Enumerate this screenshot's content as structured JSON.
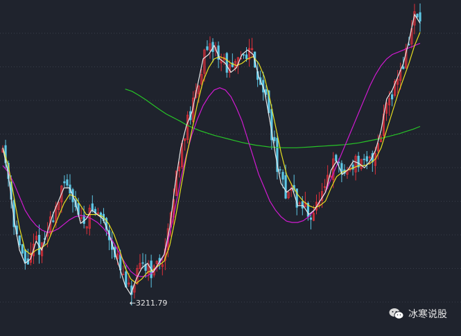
{
  "watermark": {
    "text": "冰寒说股",
    "icon": "wechat-icon"
  },
  "colors": {
    "background": "#1f232d",
    "grid": "#3a3f4b",
    "up": "#e0303a",
    "down": "#5ec8e6",
    "ma_white": "#e9e9e9",
    "ma_yellow": "#e8e020",
    "ma_magenta": "#d21ad2",
    "ma_green": "#27c427"
  },
  "chart_data": {
    "type": "candlestick",
    "grid": true,
    "low_marker": {
      "label": "3211.79",
      "value": 3211.79
    },
    "y_range": [
      3160,
      3880
    ],
    "close_path": [
      3560,
      3500,
      3400,
      3330,
      3300,
      3310,
      3350,
      3330,
      3370,
      3410,
      3440,
      3470,
      3470,
      3440,
      3390,
      3400,
      3420,
      3410,
      3400,
      3370,
      3330,
      3290,
      3250,
      3230,
      3265,
      3290,
      3300,
      3280,
      3300,
      3320,
      3380,
      3480,
      3560,
      3610,
      3640,
      3700,
      3760,
      3770,
      3790,
      3760,
      3750,
      3730,
      3740,
      3770,
      3780,
      3770,
      3720,
      3690,
      3620,
      3545,
      3480,
      3460,
      3470,
      3430,
      3430,
      3410,
      3420,
      3440,
      3460,
      3510,
      3530,
      3500,
      3510,
      3530,
      3525,
      3515,
      3530,
      3555,
      3600,
      3670,
      3690,
      3720,
      3750,
      3800,
      3860,
      3840
    ],
    "ma_short": [
      3560,
      3520,
      3450,
      3380,
      3330,
      3320,
      3330,
      3335,
      3345,
      3375,
      3405,
      3435,
      3455,
      3450,
      3430,
      3410,
      3410,
      3410,
      3405,
      3390,
      3365,
      3330,
      3290,
      3265,
      3255,
      3265,
      3280,
      3285,
      3295,
      3305,
      3340,
      3400,
      3470,
      3540,
      3600,
      3660,
      3710,
      3740,
      3760,
      3765,
      3760,
      3750,
      3745,
      3750,
      3760,
      3765,
      3750,
      3720,
      3670,
      3610,
      3550,
      3500,
      3475,
      3455,
      3440,
      3430,
      3425,
      3430,
      3440,
      3470,
      3495,
      3505,
      3510,
      3515,
      3520,
      3520,
      3525,
      3535,
      3560,
      3600,
      3640,
      3680,
      3715,
      3750,
      3790,
      3820
    ],
    "ma_mid": [
      3520,
      3505,
      3480,
      3450,
      3420,
      3400,
      3385,
      3375,
      3370,
      3372,
      3378,
      3388,
      3398,
      3405,
      3408,
      3405,
      3400,
      3392,
      3380,
      3365,
      3345,
      3322,
      3300,
      3282,
      3272,
      3270,
      3272,
      3280,
      3295,
      3320,
      3365,
      3425,
      3490,
      3545,
      3590,
      3625,
      3655,
      3675,
      3690,
      3695,
      3690,
      3675,
      3650,
      3620,
      3580,
      3540,
      3500,
      3470,
      3440,
      3420,
      3405,
      3395,
      3392,
      3392,
      3396,
      3405,
      3420,
      3440,
      3460,
      3490,
      3520,
      3550,
      3580,
      3610,
      3640,
      3670,
      3700,
      3725,
      3745,
      3760,
      3770,
      3775,
      3780,
      3785,
      3790,
      3795
    ],
    "ma_long": {
      "x_start_index": 22,
      "values": [
        3692,
        3687,
        3678,
        3668,
        3657,
        3646,
        3636,
        3628,
        3620,
        3611,
        3604,
        3598,
        3593,
        3588,
        3584,
        3580,
        3576,
        3572,
        3569,
        3566,
        3564,
        3562,
        3561,
        3560,
        3560,
        3560,
        3561,
        3562,
        3563,
        3564,
        3565,
        3566,
        3567,
        3569,
        3571,
        3574,
        3577,
        3580,
        3584,
        3588,
        3592,
        3597,
        3602,
        3608
      ]
    },
    "series": []
  }
}
